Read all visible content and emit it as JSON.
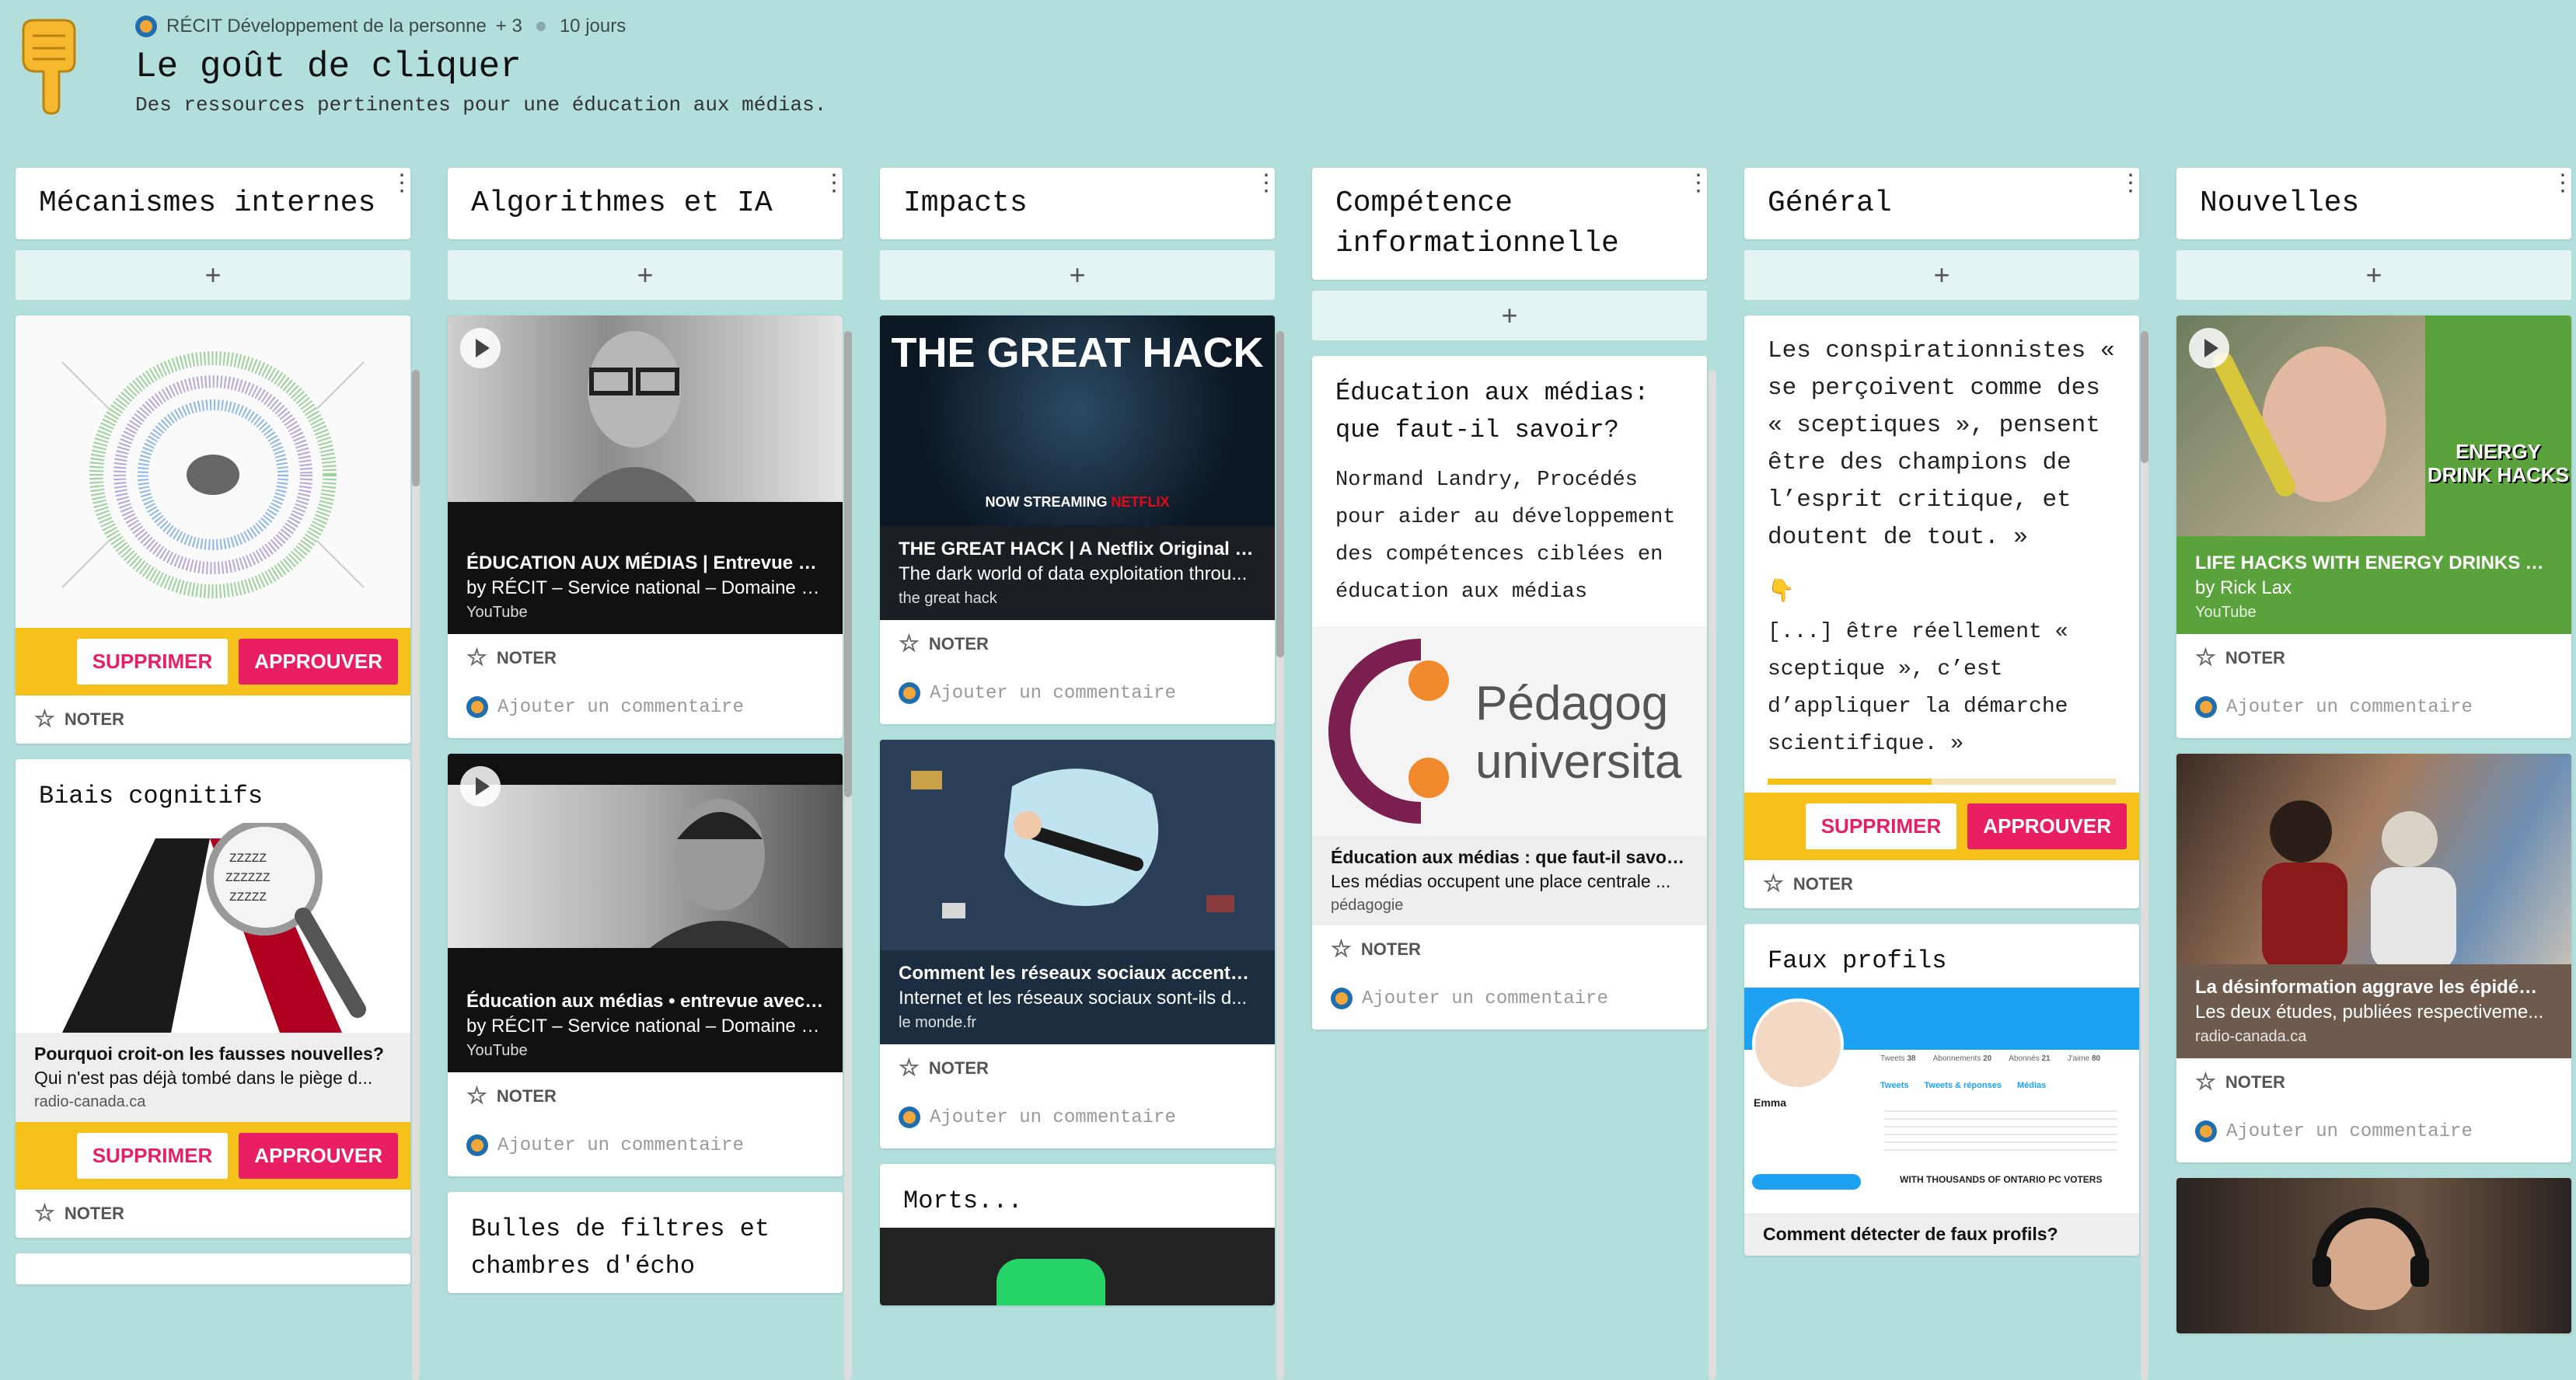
{
  "header": {
    "org": "RÉCIT Développement de la personne",
    "contributors": "+ 3",
    "age": "10 jours",
    "title": "Le goût de cliquer",
    "subtitle": "Des ressources pertinentes pour une éducation aux médias."
  },
  "labels": {
    "add": "+",
    "noter": "NOTER",
    "comment_placeholder": "Ajouter un commentaire",
    "delete": "SUPPRIMER",
    "approve": "APPROUVER"
  },
  "colors": {
    "background": "#b2dfdb",
    "approval_bar": "#f6c11b",
    "approve_button": "#e91e63"
  },
  "columns": [
    {
      "title": "Mécanismes internes",
      "cards": [
        {
          "image": "cognitive-bias-codex"
        },
        {
          "title": "Biais cognitifs",
          "link_title": "Pourquoi croit-on les fausses nouvelles?",
          "link_desc": "Qui n'est pas déjà tombé dans le piège d...",
          "link_source": "radio-canada.ca"
        }
      ]
    },
    {
      "title": "Algorithmes et IA",
      "cards": [
        {
          "link_title": "ÉDUCATION AUX MÉDIAS | Entrevue ave...",
          "link_desc": "by RÉCIT – Service national – Domaine d...",
          "link_source": "YouTube"
        },
        {
          "link_title": "Éducation aux médias • entrevue avec Ni...",
          "link_desc": "by RÉCIT – Service national – Domaine d...",
          "link_source": "YouTube"
        },
        {
          "title": "Bulles de filtres et chambres d'écho"
        }
      ]
    },
    {
      "title": "Impacts",
      "cards": [
        {
          "poster_title": "THE GREAT HACK",
          "poster_streaming": "NOW STREAMING",
          "poster_brand": "NETFLIX",
          "link_title": "THE GREAT HACK | A Netflix Original Do...",
          "link_desc": "The dark world of data exploitation throu...",
          "link_source": "the great hack"
        },
        {
          "link_title": "Comment les réseaux sociaux accentue...",
          "link_desc": "Internet et les réseaux sociaux sont-ils d...",
          "link_source": "le monde.fr"
        },
        {
          "title": "Morts..."
        }
      ]
    },
    {
      "title": "Compétence informationnelle",
      "cards": [
        {
          "title": "Éducation aux médias: que faut-il savoir?",
          "body": "Normand Landry, Procédés pour aider au développement des compétences ciblées en éducation aux médias",
          "logo_text1": "Pédagog",
          "logo_text2": "universita",
          "link_title": "Éducation aux médias : que faut-il savoir ?",
          "link_desc": "Les médias occupent une place centrale ...",
          "link_source": "pédagogie"
        }
      ]
    },
    {
      "title": "Général",
      "cards": [
        {
          "body": "Les conspirationnistes « se perçoivent comme des « sceptiques », pensent être des champions de l’esprit critique, et doutent de tout. »",
          "emoji": "👇",
          "body2": "[...] être réellement « sceptique », c’est d’appliquer la démarche scientifique. »",
          "progress": 0.47
        },
        {
          "title": "Faux profils",
          "profile_name": "Emma",
          "stats": [
            "Tweets",
            "Abonnements",
            "Abonnés",
            "J'aime"
          ],
          "stat_values": [
            "38",
            "20",
            "21",
            "80"
          ],
          "tabs": [
            "Tweets",
            "Tweets & réponses",
            "Médias"
          ],
          "ad_text": "WITH THOUSANDS OF ONTARIO PC VOTERS",
          "link_title": "Comment détecter de faux profils?"
        }
      ]
    },
    {
      "title": "Nouvelles",
      "cards": [
        {
          "overlay_text": "ENERGY DRINK HACKS",
          "link_title": "LIFE HACKS WITH ENERGY DRINKS YOU...",
          "link_desc": "by Rick Lax",
          "link_source": "YouTube"
        },
        {
          "link_title": "La désinformation aggrave les épidémies",
          "link_desc": "Les deux études, publiées respectiveme...",
          "link_source": "radio-canada.ca"
        },
        {
          "image": "man-with-headphones"
        }
      ]
    }
  ]
}
